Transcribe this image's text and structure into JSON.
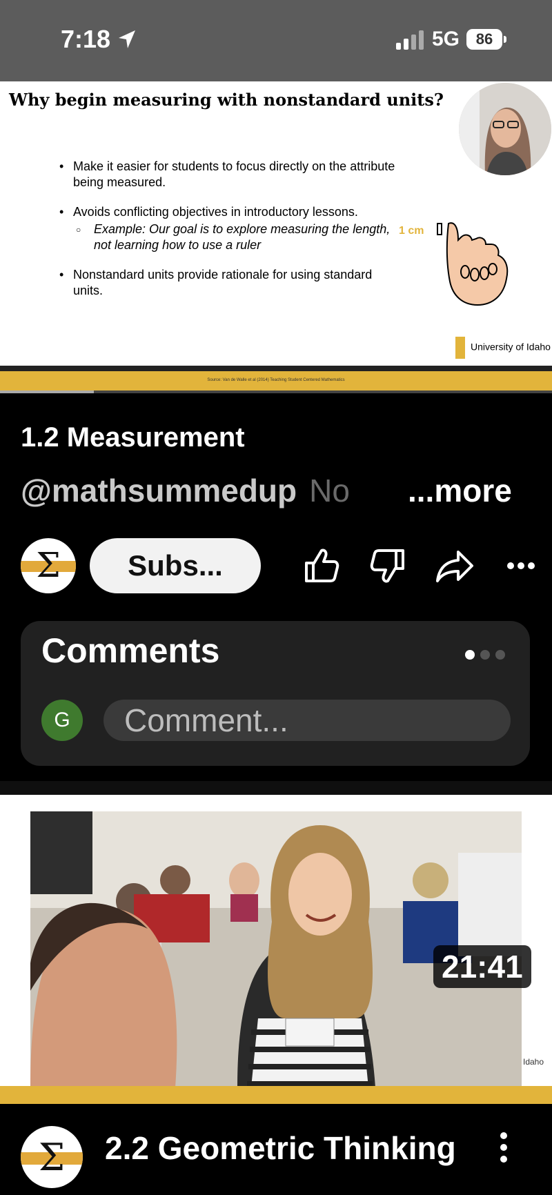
{
  "status": {
    "time": "7:18",
    "network": "5G",
    "battery": "86"
  },
  "slide": {
    "title": "Why begin measuring with nonstandard units?",
    "bullets": [
      "Make it easier for students to focus directly on the attribute being measured.",
      "Avoids conflicting objectives in introductory lessons.",
      "Nonstandard units provide rationale for using standard units."
    ],
    "sub_bullet": "Example: Our goal is to explore measuring the length, not learning how to use a ruler",
    "unit_label": "1 cm",
    "logo_text": "University of Idaho",
    "source": "Source: Van de Walle et al (2014) Teaching Student Centered Mathematics"
  },
  "video": {
    "title": "1.2 Measurement",
    "channel": "@mathsummedup",
    "desc_start": "No",
    "more": "...more",
    "subscribe": "Subs...",
    "avatar_symbol": "Σ",
    "progress": 0.17
  },
  "comments": {
    "heading": "Comments",
    "user_initial": "G",
    "placeholder": "Comment..."
  },
  "next": {
    "duration": "21:41",
    "title": "2.2 Geometric Thinking",
    "avatar_symbol": "Σ",
    "thumb_text": "Idaho"
  },
  "colors": {
    "accent": "#e2b43b",
    "user_avatar": "#3f7a2e"
  }
}
